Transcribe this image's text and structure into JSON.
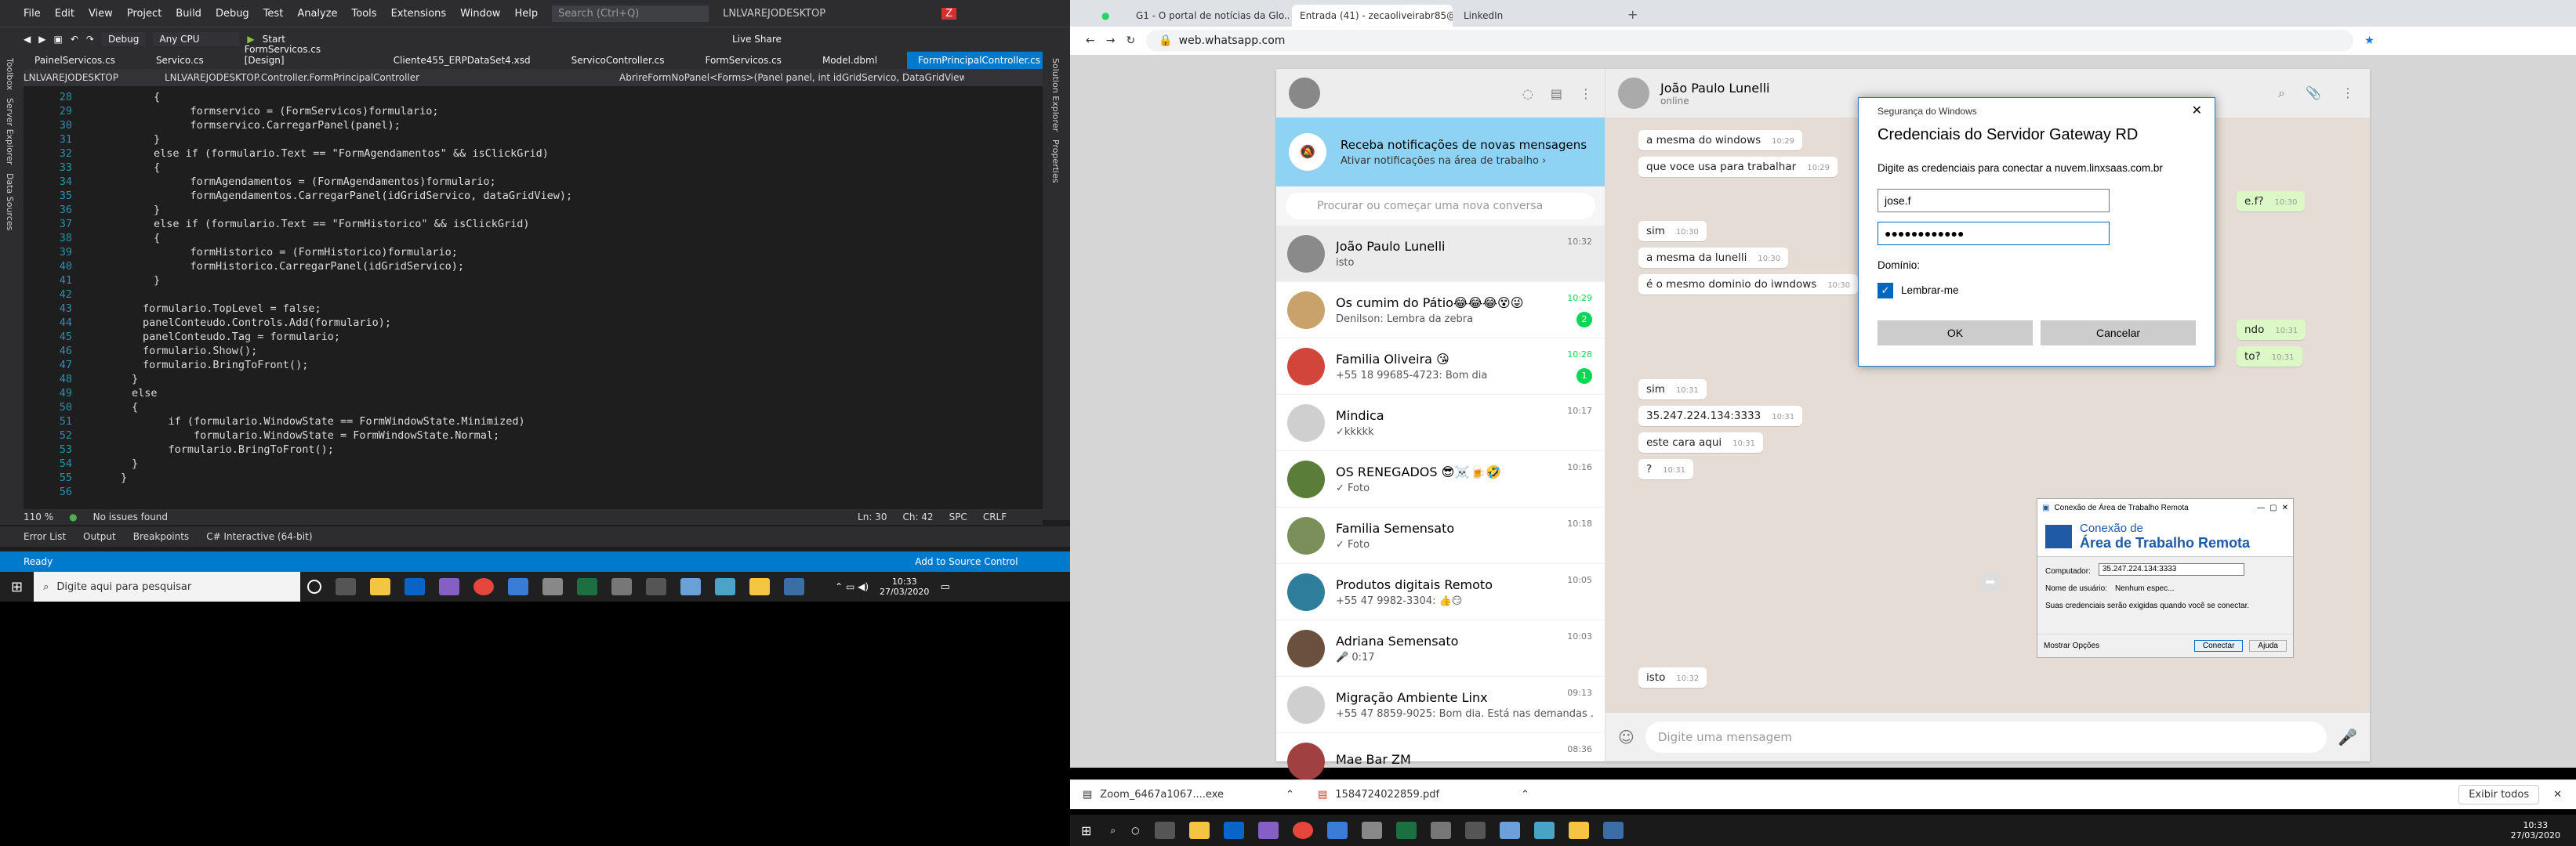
{
  "vs": {
    "menu": [
      "File",
      "Edit",
      "View",
      "Project",
      "Build",
      "Debug",
      "Test",
      "Analyze",
      "Tools",
      "Extensions",
      "Window",
      "Help"
    ],
    "search": "Search (Ctrl+Q)",
    "project": "LNLVAREJODESKTOP",
    "config": "Debug",
    "platform": "Any CPU",
    "start": "Start",
    "liveshare": "Live Share",
    "tabs": [
      "PainelServicos.cs",
      "Servico.cs",
      "FormServicos.cs [Design]",
      "Cliente455_ERPDataSet4.xsd",
      "ServicoController.cs",
      "FormServicos.cs",
      "Model.dbml",
      "FormPrincipalController.cs"
    ],
    "nav": {
      "project": "LNLVAREJODESKTOP",
      "class": "LNLVAREJODESKTOP.Controller.FormPrincipalController",
      "method": "AbrireFormNoPanel<Forms>(Panel panel, int idGridServico, DataGridView d"
    },
    "lines": [
      {
        "n": "28",
        "t": "{"
      },
      {
        "n": "29",
        "t": "    formservico = (FormServicos)formulario;"
      },
      {
        "n": "30",
        "t": "    formservico.CarregarPanel(panel);"
      },
      {
        "n": "31",
        "t": "}"
      },
      {
        "n": "32",
        "t": "else if (formulario.Text == \"FormAgendamentos\" && isClickGrid)"
      },
      {
        "n": "33",
        "t": "{"
      },
      {
        "n": "34",
        "t": "    formAgendamentos = (FormAgendamentos)formulario;"
      },
      {
        "n": "35",
        "t": "    formAgendamentos.CarregarPanel(idGridServico, dataGridView);"
      },
      {
        "n": "36",
        "t": "}"
      },
      {
        "n": "37",
        "t": "else if (formulario.Text == \"FormHistorico\" && isClickGrid)"
      },
      {
        "n": "38",
        "t": "{"
      },
      {
        "n": "39",
        "t": "    formHistorico = (FormHistorico)formulario;"
      },
      {
        "n": "40",
        "t": "    formHistorico.CarregarPanel(idGridServico);"
      },
      {
        "n": "41",
        "t": "}"
      },
      {
        "n": "42",
        "t": ""
      },
      {
        "n": "43",
        "t": "formulario.TopLevel = false;"
      },
      {
        "n": "44",
        "t": "panelConteudo.Controls.Add(formulario);"
      },
      {
        "n": "45",
        "t": "panelConteudo.Tag = formulario;"
      },
      {
        "n": "46",
        "t": "formulario.Show();"
      },
      {
        "n": "47",
        "t": "formulario.BringToFront();"
      },
      {
        "n": "48",
        "t": "}"
      },
      {
        "n": "49",
        "t": "else"
      },
      {
        "n": "50",
        "t": "{"
      },
      {
        "n": "51",
        "t": "    if (formulario.WindowState == FormWindowState.Minimized)"
      },
      {
        "n": "52",
        "t": "        formulario.WindowState = FormWindowState.Normal;"
      },
      {
        "n": "53",
        "t": "    formulario.BringToFront();"
      },
      {
        "n": "54",
        "t": "}"
      },
      {
        "n": "55",
        "t": "}"
      },
      {
        "n": "56",
        "t": ""
      }
    ],
    "zoom": "110 %",
    "issues": "No issues found",
    "ln": "Ln: 30",
    "ch": "Ch: 42",
    "spc": "SPC",
    "crlf": "CRLF",
    "bottomtabs": [
      "Error List",
      "Output",
      "Breakpoints",
      "C# Interactive (64-bit)"
    ],
    "status": "Ready",
    "source_control": "Add to Source Control",
    "sidebar_left": [
      "Toolbox",
      "Server Explorer",
      "Data Sources"
    ],
    "sidebar_right": [
      "Solution Explorer",
      "Properties"
    ]
  },
  "taskbar1": {
    "search": "Digite aqui para pesquisar",
    "time": "10:33",
    "date": "27/03/2020"
  },
  "chrome": {
    "tabs": [
      "",
      "G1 - O portal de notícias da Glo...",
      "Entrada (41) - zecaoliveirabr85@...",
      "LinkedIn"
    ],
    "url": "web.whatsapp.com"
  },
  "wa": {
    "notif_title": "Receba notificações de novas mensagens",
    "notif_sub": "Ativar notificações na área de trabalho ›",
    "search": "Procurar ou começar uma nova conversa",
    "chats": [
      {
        "name": "João Paulo Lunelli",
        "last": "isto",
        "time": "10:32",
        "badge": ""
      },
      {
        "name": "Os cumim do Pátio😂😂😂😵😜",
        "last": "Denilson: Lembra da zebra",
        "time": "10:29",
        "badge": "2"
      },
      {
        "name": "Familia Oliveira 😘",
        "last": "+55 18 99685-4723: Bom dia",
        "time": "10:28",
        "badge": "1"
      },
      {
        "name": "Mindica",
        "last": "✓kkkkk",
        "time": "10:17",
        "badge": ""
      },
      {
        "name": "OS RENEGADOS 😎☠️🍺🤣",
        "last": "✓ Foto",
        "time": "10:16",
        "badge": ""
      },
      {
        "name": "Familia Semensato",
        "last": "✓ Foto",
        "time": "10:18",
        "badge": ""
      },
      {
        "name": "Produtos digitais Remoto",
        "last": "+55 47 9982-3304: 👍😏",
        "time": "10:05",
        "badge": ""
      },
      {
        "name": "Adriana Semensato",
        "last": "🎤 0:17",
        "time": "10:03",
        "badge": ""
      },
      {
        "name": "Migração Ambiente Linx",
        "last": "+55 47 8859-9025: Bom dia. Está nas demandas ...",
        "time": "09:13",
        "badge": ""
      },
      {
        "name": "Mae Bar ZM",
        "last": "",
        "time": "08:36",
        "badge": ""
      }
    ],
    "contact": "João Paulo Lunelli",
    "status": "online",
    "messages": [
      {
        "text": "a mesma do windows",
        "time": "10:29"
      },
      {
        "text": "que voce usa para trabalhar",
        "time": "10:29"
      },
      {
        "text": "sim",
        "time": "10:30"
      },
      {
        "text": "a mesma da lunelli",
        "time": "10:30"
      },
      {
        "text": "é o mesmo dominio do iwndows",
        "time": "10:30"
      },
      {
        "text": "sim",
        "time": "10:31"
      },
      {
        "text": "35.247.224.134:3333",
        "time": "10:31"
      },
      {
        "text": "este cara aqui",
        "time": "10:31"
      },
      {
        "text": "?",
        "time": "10:31"
      },
      {
        "text": "isto",
        "time": "10:32"
      }
    ],
    "out_partial": [
      {
        "text": "e.f?",
        "time": "10:30"
      },
      {
        "text": "ndo",
        "time": "10:31"
      },
      {
        "text": "to?",
        "time": "10:31"
      }
    ],
    "compose": "Digite uma mensagem"
  },
  "dialog": {
    "caption": "Segurança do Windows",
    "title": "Credenciais do Servidor Gateway RD",
    "prompt": "Digite as credenciais para conectar a nuvem.linxsaas.com.br",
    "user": "jose.f",
    "password": "●●●●●●●●●●●●",
    "domain": "Domínio:",
    "remember": "Lembrar-me",
    "ok": "OK",
    "cancel": "Cancelar"
  },
  "rdp": {
    "caption": "Conexão de Área de Trabalho Remota",
    "title1": "Conexão de",
    "title2": "Área de Trabalho Remota",
    "computer_label": "Computador:",
    "computer": "35.247.224.134:3333",
    "user_label": "Nome de usuário:",
    "user": "Nenhum espec...",
    "info": "Suas credenciais serão exigidas quando você se conectar.",
    "options": "Mostrar Opções",
    "connect": "Conectar",
    "help": "Ajuda"
  },
  "downloads": [
    {
      "name": "Zoom_6467a1067....exe"
    },
    {
      "name": "1584724022859.pdf"
    }
  ],
  "show_all": "Exibir todos",
  "taskbar2": {
    "time": "10:33",
    "date": "27/03/2020"
  }
}
